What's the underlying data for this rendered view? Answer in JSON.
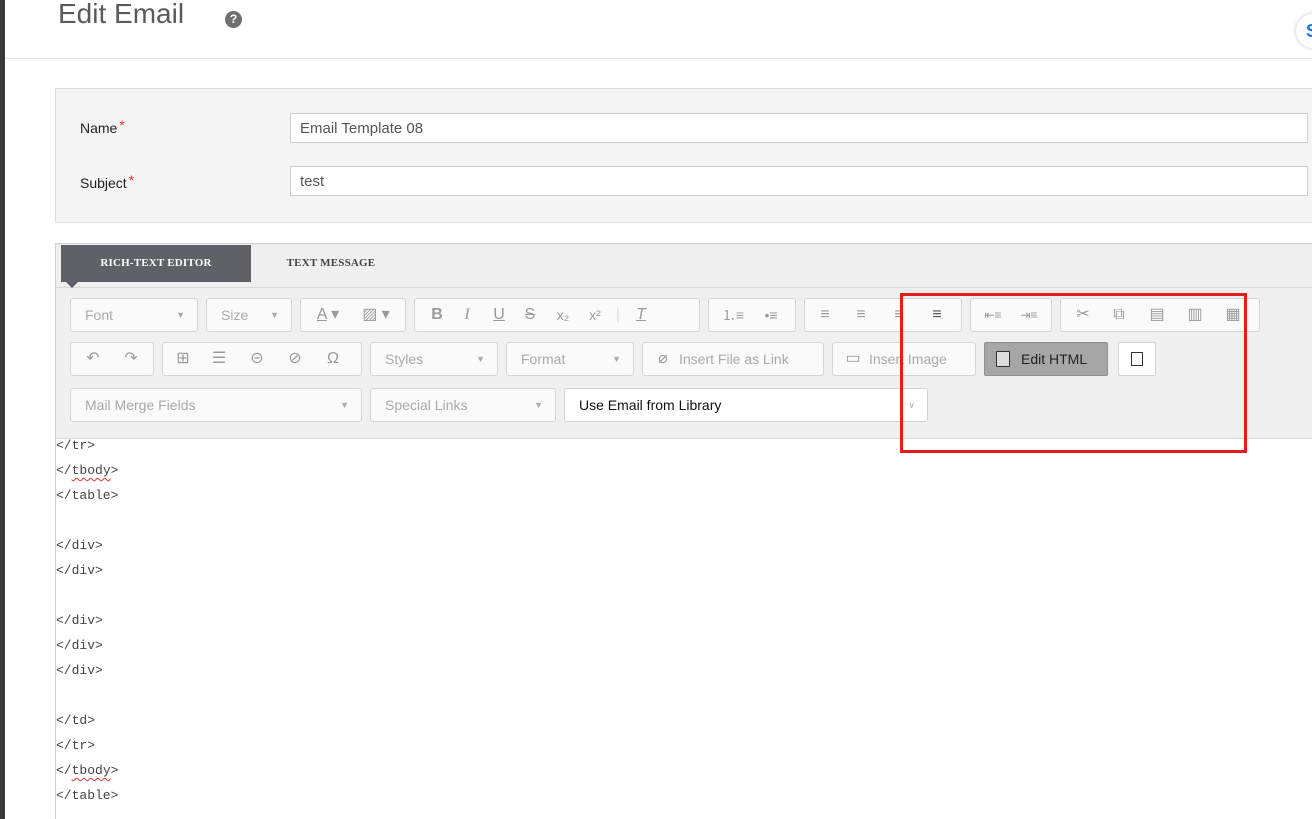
{
  "page": {
    "title": "Edit Email",
    "help_icon": "question-icon",
    "corner_glyph": "S"
  },
  "form": {
    "name_label": "Name",
    "name_value": "Email Template 08",
    "subject_label": "Subject",
    "subject_value": "test",
    "required_marker": "*"
  },
  "editor": {
    "tabs": [
      "RICH-TEXT EDITOR",
      "TEXT MESSAGE"
    ],
    "toolbar": {
      "font_label": "Font",
      "size_label": "Size",
      "styles_label": "Styles",
      "format_label": "Format",
      "insert_file_link": "Insert File as Link",
      "insert_image": "Insert Image",
      "edit_html": "Edit HTML",
      "mail_merge": "Mail Merge Fields",
      "special_links": "Special Links",
      "email_library": "Use Email from Library"
    },
    "code_lines": [
      "</tr>",
      "</tbody>",
      "</table>",
      "",
      "</div>",
      "</div>",
      "",
      "</div>",
      "</div>",
      "</div>",
      "",
      "</td>",
      "</tr>",
      "</tbody>",
      "</table>"
    ]
  },
  "colors": {
    "active_tab": "#5f6167",
    "highlight": "#e31c1c",
    "required": "#ee3333"
  }
}
